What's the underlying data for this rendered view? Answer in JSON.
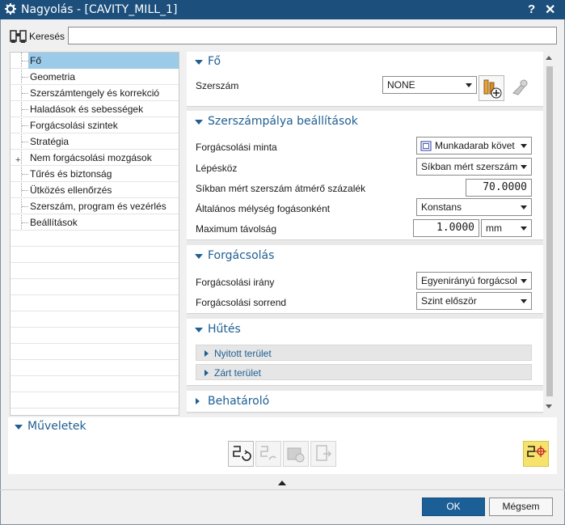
{
  "window": {
    "title": "Nagyolás - [CAVITY_MILL_1]",
    "help": "?",
    "close": "✕"
  },
  "search": {
    "label": "Keresés",
    "value": ""
  },
  "tree": {
    "items": [
      {
        "label": "Fő"
      },
      {
        "label": "Geometria"
      },
      {
        "label": "Szerszámtengely és korrekció"
      },
      {
        "label": "Haladások és sebességek"
      },
      {
        "label": "Forgácsolási szintek"
      },
      {
        "label": "Stratégia"
      },
      {
        "label": "Nem forgácsolási mozgások"
      },
      {
        "label": "Tűrés és biztonság"
      },
      {
        "label": "Ütközés ellenőrzés"
      },
      {
        "label": "Szerszám, program és vezérlés"
      },
      {
        "label": "Beállítások"
      }
    ],
    "selected": "Fő"
  },
  "sections": {
    "fo": {
      "title": "Fő",
      "tool_label": "Szerszám",
      "tool_value": "NONE"
    },
    "toolpath": {
      "title": "Szerszámpálya beállítások",
      "pattern_label": "Forgácsolási minta",
      "pattern_value": "Munkadarab követ",
      "step_label": "Lépésköz",
      "step_value": "Síkban mért szerszám",
      "percent_label": "Síkban mért szerszám átmérő százalék",
      "percent_value": "70.0000",
      "depth_label": "Általános mélység fogásonként",
      "depth_value": "Konstans",
      "maxdist_label": "Maximum távolság",
      "maxdist_value": "1.0000",
      "maxdist_unit": "mm"
    },
    "cutting": {
      "title": "Forgácsolás",
      "direction_label": "Forgácsolási irány",
      "direction_value": "Egyenirányú forgácsol",
      "order_label": "Forgácsolási sorrend",
      "order_value": "Szint először"
    },
    "cooling": {
      "title": "Hűtés",
      "open_area": "Nyitott terület",
      "closed_area": "Zárt terület"
    },
    "limiter": {
      "title": "Behatároló"
    }
  },
  "operations": {
    "title": "Műveletek"
  },
  "footer": {
    "ok": "OK",
    "cancel": "Mégsem"
  },
  "colors": {
    "titlebar": "#1c4f7c",
    "accent": "#1f5f93",
    "selection": "#9ccbea",
    "highlight_button": "#f7e36b"
  }
}
